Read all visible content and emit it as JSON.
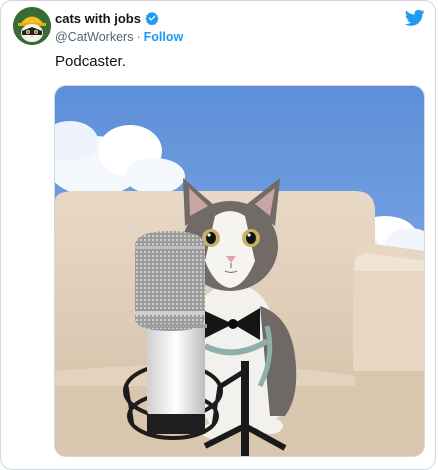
{
  "account": {
    "display_name": "cats with jobs",
    "handle": "@CatWorkers",
    "separator": "·",
    "follow_label": "Follow"
  },
  "tweet": {
    "text": "Podcaster."
  },
  "icons": {
    "verified": "verified-badge-icon",
    "brand": "twitter-bird-icon"
  },
  "colors": {
    "accent": "#1d9bf0",
    "text_primary": "#0f1419",
    "text_secondary": "#536471"
  }
}
